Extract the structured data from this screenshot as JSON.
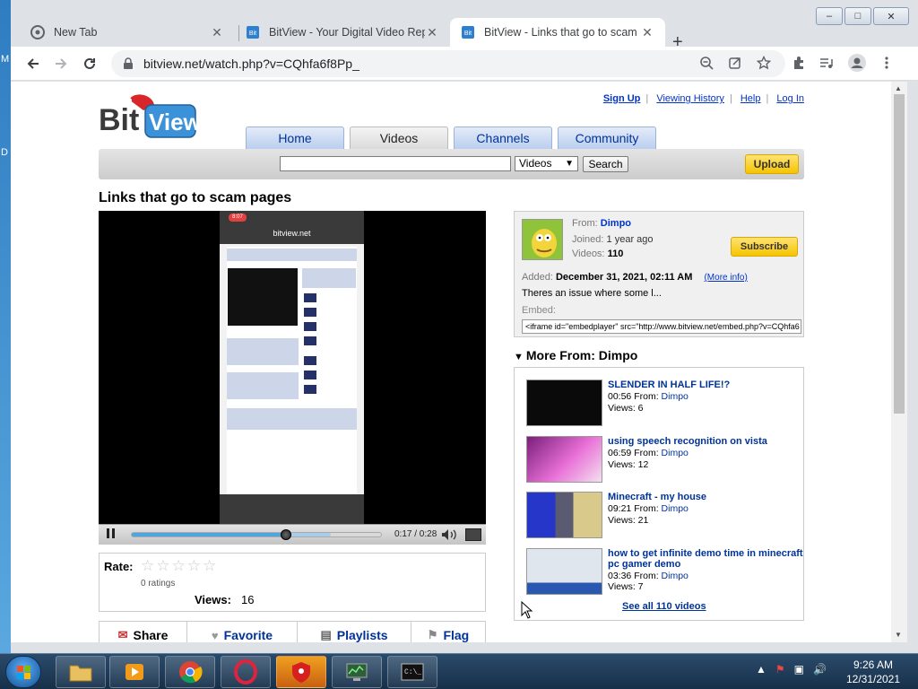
{
  "desktop": {
    "labels": [
      "M",
      "D"
    ]
  },
  "browser": {
    "tabs": [
      {
        "title": "New Tab",
        "active": false
      },
      {
        "title": "BitView - Your Digital Video Repo",
        "active": false
      },
      {
        "title": "BitView - Links that go to scam p",
        "active": true
      }
    ],
    "new_tab_symbol": "+",
    "address": "bitview.net/watch.php?v=CQhfa6f8Pp_",
    "window_controls": [
      "–",
      "□",
      "✕"
    ]
  },
  "site": {
    "top_links": [
      "Sign Up",
      "Viewing History",
      "Help",
      "Log In"
    ],
    "nav_tabs": [
      "Home",
      "Videos",
      "Channels",
      "Community"
    ],
    "selected_nav": "Videos",
    "search": {
      "value": "",
      "category": "Videos",
      "button": "Search"
    },
    "upload": "Upload"
  },
  "video": {
    "title": "Links that go to scam pages",
    "phone_url": "bitview.net",
    "phone_time": "8:07",
    "time": "0:17 / 0:28",
    "progress": 0.62,
    "buffered": 0.8,
    "rate_label": "Rate:",
    "stars": "☆☆☆☆☆",
    "ratings": "0 ratings",
    "views_label": "Views:",
    "views": "16",
    "actions": [
      "Share",
      "Favorite",
      "Playlists",
      "Flag"
    ]
  },
  "uploader": {
    "from_label": "From:",
    "name": "Dimpo",
    "joined_label": "Joined:",
    "joined": "1 year ago",
    "videos_label": "Videos:",
    "videos": "110",
    "subscribe": "Subscribe",
    "added_label": "Added:",
    "added": "December 31, 2021, 02:11 AM",
    "more_info": "(More info)",
    "description": "Theres an issue where some l...",
    "embed_label": "Embed:",
    "embed_code": "<iframe id=\"embedplayer\" src=\"http://www.bitview.net/embed.php?v=CQhfa6"
  },
  "more_from": {
    "heading": "More From: Dimpo",
    "items": [
      {
        "title": "SLENDER IN HALF LIFE!?",
        "duration": "00:56",
        "from": "From:",
        "author": "Dimpo",
        "views": "Views: 6"
      },
      {
        "title": "using speech recognition on vista",
        "duration": "06:59",
        "from": "From:",
        "author": "Dimpo",
        "views": "Views: 12"
      },
      {
        "title": "Minecraft - my house",
        "duration": "09:21",
        "from": "From:",
        "author": "Dimpo",
        "views": "Views: 21"
      },
      {
        "title": "how to get infinite demo time in minecraft pc gamer demo",
        "duration": "03:36",
        "from": "From:",
        "author": "Dimpo",
        "views": "Views: 7"
      }
    ],
    "see_all": "See all 110 videos"
  },
  "taskbar": {
    "time": "9:26 AM",
    "date": "12/31/2021"
  }
}
